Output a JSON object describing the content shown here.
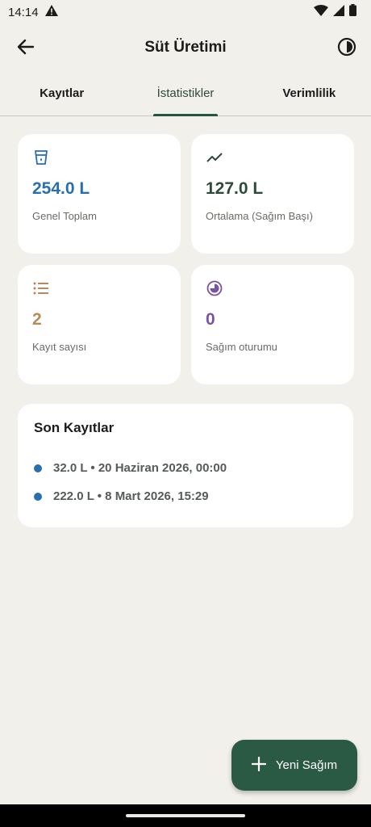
{
  "status": {
    "time": "14:14"
  },
  "app_bar": {
    "title": "Süt Üretimi"
  },
  "tabs": [
    {
      "label": "Kayıtlar",
      "active": false
    },
    {
      "label": "İstatistikler",
      "active": true
    },
    {
      "label": "Verimlilik",
      "active": false
    }
  ],
  "stats": {
    "total": {
      "value": "254.0 L",
      "label": "Genel Toplam",
      "color": "#2a6fad",
      "icon": "cup-icon"
    },
    "average": {
      "value": "127.0 L",
      "label": "Ortalama (Sağım Başı)",
      "color": "#2e4a3c",
      "icon": "trending-icon"
    },
    "count": {
      "value": "2",
      "label": "Kayıt sayısı",
      "color": "#b8895a",
      "icon": "list-icon"
    },
    "sessions": {
      "value": "0",
      "label": "Sağım oturumu",
      "color": "#7a52a3",
      "icon": "clock-pie-icon"
    }
  },
  "recent": {
    "title": "Son Kayıtlar",
    "items": [
      {
        "text": "32.0 L • 20 Haziran 2026, 00:00"
      },
      {
        "text": "222.0 L • 8 Mart 2026, 15:29"
      }
    ]
  },
  "fab": {
    "label": "Yeni Sağım"
  },
  "colors": {
    "background": "#f2f0eb",
    "accent": "#2b5a44",
    "tab_indicator": "#23553f"
  }
}
